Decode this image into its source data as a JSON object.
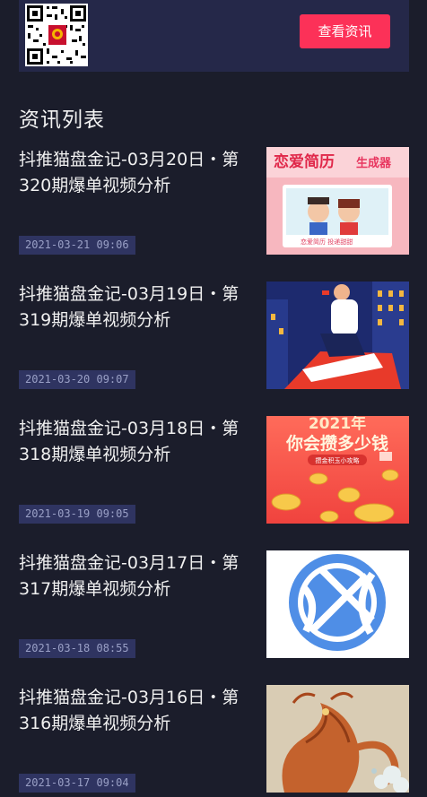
{
  "header": {
    "button_label": "查看资讯"
  },
  "section_title": "资讯列表",
  "articles": [
    {
      "title": "抖推猫盘金记-03月20日・第320期爆单视频分析",
      "date": "2021-03-21 09:06",
      "thumb_title": "恋爱简历",
      "thumb_subtitle": "生成器",
      "thumb_caption": "恋爱简历  投递甜甜"
    },
    {
      "title": "抖推猫盘金记-03月19日・第319期爆单视频分析",
      "date": "2021-03-20 09:07"
    },
    {
      "title": "抖推猫盘金记-03月18日・第318期爆单视频分析",
      "date": "2021-03-19 09:05",
      "thumb_line1": "2021年",
      "thumb_line2": "你会攒多少钱",
      "thumb_caption": "攒金积玉小攻略"
    },
    {
      "title": "抖推猫盘金记-03月17日・第317期爆单视频分析",
      "date": "2021-03-18 08:55"
    },
    {
      "title": "抖推猫盘金记-03月16日・第316期爆单视频分析",
      "date": "2021-03-17 09:04"
    }
  ]
}
